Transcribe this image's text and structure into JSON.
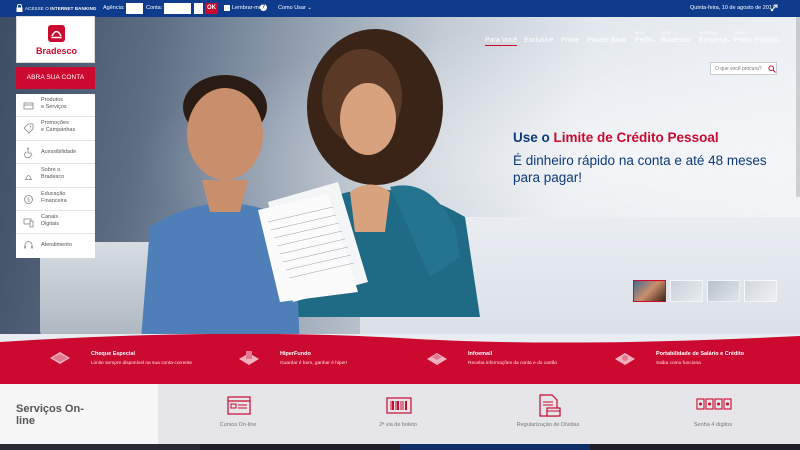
{
  "topbar": {
    "access_prefix": "ACESSE O",
    "access_bold": "INTERNET BANKING",
    "agency_label": "Agência:",
    "account_label": "Conta:",
    "agency_value": "",
    "account_value": "",
    "ok_label": "OK",
    "remember_label": "Lembrar-me",
    "help_symbol": "?",
    "how_to_use": "Como Usar",
    "date": "Quinta-feira, 10 de agosto de 2017"
  },
  "brand": {
    "name": "Bradesco",
    "color": "#cc092f"
  },
  "open_account": "ABRA SUA CONTA",
  "sidemenu": [
    {
      "line1": "Produtos",
      "line2": "e Serviços",
      "icon": "products-icon"
    },
    {
      "line1": "Promoções",
      "line2": "e Campanhas",
      "icon": "promotions-icon"
    },
    {
      "line1": "Acessibilidade",
      "line2": "",
      "icon": "accessibility-icon"
    },
    {
      "line1": "Sobre o",
      "line2": "Bradesco",
      "icon": "about-icon"
    },
    {
      "line1": "Educação",
      "line2": "Financeira",
      "icon": "education-icon"
    },
    {
      "line1": "Canais",
      "line2": "Digitais",
      "icon": "digital-channels-icon"
    },
    {
      "line1": "Atendimento",
      "line2": "",
      "icon": "support-icon"
    }
  ],
  "nav": [
    {
      "small": "",
      "label": "Para Você",
      "active": true
    },
    {
      "small": "",
      "label": "Exclusive"
    },
    {
      "small": "",
      "label": "Prime"
    },
    {
      "small": "",
      "label": "Private Bank"
    },
    {
      "small": "MAIS",
      "label": "Perfis"
    },
    {
      "small": "MAIS",
      "label": "Bradesco"
    },
    {
      "small": "PARA SUA",
      "label": "Empresa"
    },
    {
      "small": "PARA O",
      "label": "Poder Público"
    }
  ],
  "search": {
    "placeholder": "O que você procura?"
  },
  "hero": {
    "headline_prefix": "Use o",
    "headline_highlight": "Limite de Crédito Pessoal",
    "subline": "É dinheiro rápido na conta e até 48 meses para pagar!"
  },
  "features": [
    {
      "title": "Cheque Especial",
      "desc": "Limite sempre disponível na sua conta-corrente"
    },
    {
      "title": "HiperFundo",
      "desc": "Guardar é bom, ganhar é hiper!"
    },
    {
      "title": "Infoemail",
      "desc": "Receba informações da conta e do cartão"
    },
    {
      "title": "Portabilidade de Salário e Crédito",
      "desc": "Saiba como funciona"
    }
  ],
  "services": {
    "title": "Serviços On-line",
    "items": [
      {
        "label": "Cursos On-line",
        "icon": "courses-icon"
      },
      {
        "label": "2ª via de boleto",
        "icon": "barcode-icon"
      },
      {
        "label": "Regularização de Dívidas",
        "icon": "document-icon"
      },
      {
        "label": "Senha 4 dígitos",
        "icon": "password-icon"
      }
    ]
  }
}
